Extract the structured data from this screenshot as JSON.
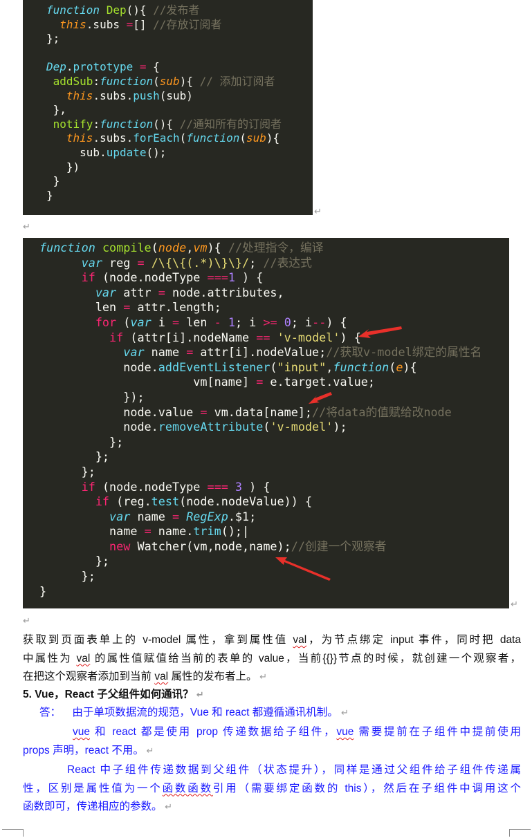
{
  "return_mark": "↵",
  "code_block_1": [
    [
      [
        "kw",
        "function"
      ],
      [
        "pl",
        " "
      ],
      [
        "fn",
        "Dep"
      ],
      [
        "pl",
        "(){ "
      ],
      [
        "cm",
        "//发布者"
      ]
    ],
    [
      [
        "pl",
        "  "
      ],
      [
        "th",
        "this"
      ],
      [
        "pl",
        ".subs "
      ],
      [
        "op",
        "="
      ],
      [
        "pl",
        "[] "
      ],
      [
        "cm",
        "//存放订阅者"
      ]
    ],
    [
      [
        "pl",
        "};"
      ]
    ],
    [],
    [
      [
        "cl",
        "Dep"
      ],
      [
        "pl",
        "."
      ],
      [
        "me",
        "prototype"
      ],
      [
        "pl",
        " "
      ],
      [
        "op",
        "="
      ],
      [
        "pl",
        " {"
      ]
    ],
    [
      [
        "pl",
        " "
      ],
      [
        "fn",
        "addSub"
      ],
      [
        "pl",
        ":"
      ],
      [
        "kw",
        "function"
      ],
      [
        "pl",
        "("
      ],
      [
        "pa",
        "sub"
      ],
      [
        "pl",
        "){ "
      ],
      [
        "cm",
        "// 添加订阅者"
      ]
    ],
    [
      [
        "pl",
        "   "
      ],
      [
        "th",
        "this"
      ],
      [
        "pl",
        ".subs."
      ],
      [
        "me",
        "push"
      ],
      [
        "pl",
        "(sub)"
      ]
    ],
    [
      [
        "pl",
        " },"
      ]
    ],
    [
      [
        "pl",
        " "
      ],
      [
        "fn",
        "notify"
      ],
      [
        "pl",
        ":"
      ],
      [
        "kw",
        "function"
      ],
      [
        "pl",
        "(){ "
      ],
      [
        "cm",
        "//通知所有的订阅者"
      ]
    ],
    [
      [
        "pl",
        "   "
      ],
      [
        "th",
        "this"
      ],
      [
        "pl",
        ".subs."
      ],
      [
        "me",
        "forEach"
      ],
      [
        "pl",
        "("
      ],
      [
        "kw",
        "function"
      ],
      [
        "pl",
        "("
      ],
      [
        "pa",
        "sub"
      ],
      [
        "pl",
        "){"
      ]
    ],
    [
      [
        "pl",
        "     sub."
      ],
      [
        "me",
        "update"
      ],
      [
        "pl",
        "();"
      ]
    ],
    [
      [
        "pl",
        "   })"
      ]
    ],
    [
      [
        "pl",
        " }"
      ]
    ],
    [
      [
        "pl",
        "}"
      ]
    ]
  ],
  "code_block_2": [
    [
      [
        "kw",
        "function"
      ],
      [
        "pl",
        " "
      ],
      [
        "fn",
        "compile"
      ],
      [
        "pl",
        "("
      ],
      [
        "pa",
        "node"
      ],
      [
        "pl",
        ","
      ],
      [
        "pa",
        "vm"
      ],
      [
        "pl",
        "){ "
      ],
      [
        "cm",
        "//处理指令，编译"
      ]
    ],
    [
      [
        "pl",
        "      "
      ],
      [
        "kw",
        "var"
      ],
      [
        "pl",
        " reg "
      ],
      [
        "op",
        "="
      ],
      [
        "pl",
        " "
      ],
      [
        "st",
        "/\\{\\{(.*)\\}\\}/"
      ],
      [
        "pl",
        "; "
      ],
      [
        "cm",
        "//表达式"
      ]
    ],
    [
      [
        "pl",
        "      "
      ],
      [
        "ct",
        "if"
      ],
      [
        "pl",
        " (node.nodeType "
      ],
      [
        "op",
        "==="
      ],
      [
        "nu",
        "1"
      ],
      [
        "pl",
        " ) {"
      ]
    ],
    [
      [
        "pl",
        "        "
      ],
      [
        "kw",
        "var"
      ],
      [
        "pl",
        " attr "
      ],
      [
        "op",
        "="
      ],
      [
        "pl",
        " node.attributes,"
      ]
    ],
    [
      [
        "pl",
        "        len "
      ],
      [
        "op",
        "="
      ],
      [
        "pl",
        " attr.length;"
      ]
    ],
    [
      [
        "pl",
        "        "
      ],
      [
        "ct",
        "for"
      ],
      [
        "pl",
        " ("
      ],
      [
        "kw",
        "var"
      ],
      [
        "pl",
        " i "
      ],
      [
        "op",
        "="
      ],
      [
        "pl",
        " len "
      ],
      [
        "op",
        "-"
      ],
      [
        "pl",
        " "
      ],
      [
        "nu",
        "1"
      ],
      [
        "pl",
        "; i "
      ],
      [
        "op",
        "&gt;="
      ],
      [
        "pl",
        " "
      ],
      [
        "nu",
        "0"
      ],
      [
        "pl",
        "; i"
      ],
      [
        "op",
        "--"
      ],
      [
        "pl",
        ") {"
      ]
    ],
    [
      [
        "pl",
        "          "
      ],
      [
        "ct",
        "if"
      ],
      [
        "pl",
        " (attr[i].nodeName "
      ],
      [
        "op",
        "=="
      ],
      [
        "pl",
        " "
      ],
      [
        "st",
        "'v-model'"
      ],
      [
        "pl",
        ") {"
      ]
    ],
    [
      [
        "pl",
        "            "
      ],
      [
        "kw",
        "var"
      ],
      [
        "pl",
        " name "
      ],
      [
        "op",
        "="
      ],
      [
        "pl",
        " attr[i].nodeValue;"
      ],
      [
        "cm",
        "//获取v-model绑定的属性名"
      ]
    ],
    [
      [
        "pl",
        "            node."
      ],
      [
        "me",
        "addEventListener"
      ],
      [
        "pl",
        "("
      ],
      [
        "st",
        "\"input\""
      ],
      [
        "pl",
        ","
      ],
      [
        "kw",
        "function"
      ],
      [
        "pl",
        "("
      ],
      [
        "pa",
        "e"
      ],
      [
        "pl",
        "){"
      ]
    ],
    [
      [
        "pl",
        "                      vm[name] "
      ],
      [
        "op",
        "="
      ],
      [
        "pl",
        " e.target.value;"
      ]
    ],
    [
      [
        "pl",
        "            });"
      ]
    ],
    [
      [
        "pl",
        "            node.value "
      ],
      [
        "op",
        "="
      ],
      [
        "pl",
        " vm.data[name];"
      ],
      [
        "cm",
        "//将data的值赋给改node"
      ]
    ],
    [
      [
        "pl",
        "            node."
      ],
      [
        "me",
        "removeAttribute"
      ],
      [
        "pl",
        "("
      ],
      [
        "st",
        "'v-model'"
      ],
      [
        "pl",
        ");"
      ]
    ],
    [
      [
        "pl",
        "          };"
      ]
    ],
    [
      [
        "pl",
        "        };"
      ]
    ],
    [
      [
        "pl",
        "      };"
      ]
    ],
    [
      [
        "pl",
        "      "
      ],
      [
        "ct",
        "if"
      ],
      [
        "pl",
        " (node.nodeType "
      ],
      [
        "op",
        "==="
      ],
      [
        "pl",
        " "
      ],
      [
        "nu",
        "3"
      ],
      [
        "pl",
        " ) {"
      ]
    ],
    [
      [
        "pl",
        "        "
      ],
      [
        "ct",
        "if"
      ],
      [
        "pl",
        " (reg."
      ],
      [
        "me",
        "test"
      ],
      [
        "pl",
        "(node.nodeValue)) {"
      ]
    ],
    [
      [
        "pl",
        "          "
      ],
      [
        "kw",
        "var"
      ],
      [
        "pl",
        " name "
      ],
      [
        "op",
        "="
      ],
      [
        "pl",
        " "
      ],
      [
        "cl",
        "RegExp"
      ],
      [
        "pl",
        ".$1;"
      ]
    ],
    [
      [
        "pl",
        "          name "
      ],
      [
        "op",
        "="
      ],
      [
        "pl",
        " name."
      ],
      [
        "me",
        "trim"
      ],
      [
        "pl",
        "();|"
      ]
    ],
    [
      [
        "pl",
        "          "
      ],
      [
        "ct",
        "new"
      ],
      [
        "pl",
        " Watcher(vm,node,name);"
      ],
      [
        "cm",
        "//创建一个观察者"
      ]
    ],
    [
      [
        "pl",
        "        };"
      ]
    ],
    [
      [
        "pl",
        "      };"
      ]
    ],
    [
      [
        "pl",
        "}"
      ]
    ]
  ],
  "paragraph": {
    "lines": [
      [
        [
          "t",
          "获取到页面表单上的 v-model 属性，拿到属性值 "
        ],
        [
          "sq",
          "val"
        ],
        [
          "t",
          "，为节点绑定 input 事件，同时把 data"
        ]
      ],
      [
        [
          "t",
          "中属性为 "
        ],
        [
          "sq",
          "val"
        ],
        [
          "t",
          " 的属性值赋值给当前的表单的 value，当前{{}}节点的时候，就创建一个观察者，"
        ]
      ],
      [
        [
          "t",
          "在把这个观察者添加到当前 "
        ],
        [
          "sq",
          "val"
        ],
        [
          "t",
          " 属性的发布者上。"
        ]
      ]
    ]
  },
  "heading": "5.  Vue，React 子父组件如何通讯？",
  "answer": {
    "label": "答：",
    "intro": "由于单项数据流的规范，Vue 和 react 都遵循通讯机制。",
    "p1": [
      [
        [
          "sq",
          "vue"
        ],
        [
          "t",
          " 和 react 都是使用 prop 传递数据给子组件，"
        ],
        [
          "sq",
          "vue"
        ],
        [
          "t",
          " 需要提前在子组件中提前使用"
        ]
      ],
      [
        [
          "t",
          "props 声明，react 不用。"
        ]
      ]
    ],
    "p2": [
      [
        [
          "t",
          "React 中子组件传递数据到父组件（状态提升），同样是通过父组件给子组件传递属"
        ]
      ],
      [
        [
          "t",
          "性，区别是属性值为一个"
        ],
        [
          "sq",
          "函数函数"
        ],
        [
          "t",
          "引用（需要绑定函数的 this），然后在子组件中调用这个"
        ]
      ],
      [
        [
          "t",
          "函数即可，传递相应的参数。"
        ]
      ]
    ]
  },
  "colors": {
    "code_bg": "#272822",
    "answer_text": "#1a1aff",
    "arrow": "#e8302a",
    "spell_underline": "#e02020"
  }
}
